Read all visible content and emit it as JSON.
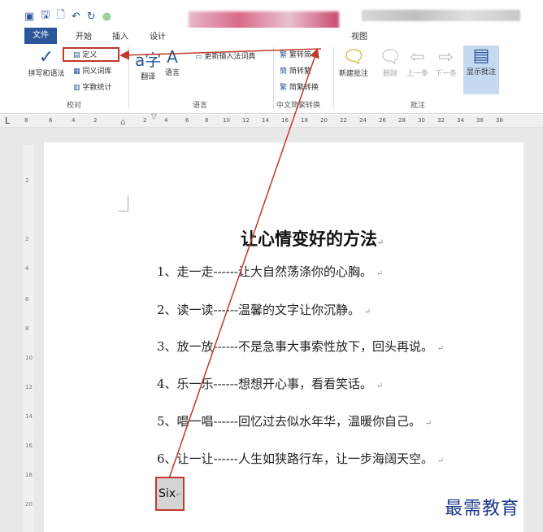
{
  "qat": {
    "icons": [
      "word-icon",
      "save-icon",
      "preview-icon",
      "undo-icon",
      "redo-icon",
      "circle-icon"
    ]
  },
  "tabs": [
    "文件",
    "开始",
    "插入",
    "设计",
    "视图"
  ],
  "ribbon": {
    "spelling": "拼写和语法",
    "define": "定义",
    "thesaurus": "同义词库",
    "wordcount": "字数统计",
    "proofing": "校对",
    "translate": "翻译",
    "language_btn": "语言",
    "language_grp": "语言",
    "ime_update": "更新输入法词典",
    "to_trad": "繁转简",
    "to_simp": "简转繁",
    "convert": "简繁转换",
    "chinese_conv": "中文简繁转换",
    "new_comment": "新建批注",
    "delete": "删除",
    "prev": "上一条",
    "next": "下一条",
    "show_comments": "显示批注",
    "comments": "批注"
  },
  "ruler": [
    "8",
    "6",
    "4",
    "2",
    "2",
    "4",
    "6",
    "8",
    "10",
    "12",
    "14",
    "16",
    "18",
    "20",
    "22",
    "24",
    "26",
    "28",
    "30",
    "32",
    "34",
    "36",
    "38"
  ],
  "vruler": [
    "2",
    "2",
    "4",
    "6",
    "8",
    "10",
    "12",
    "14",
    "16",
    "18",
    "20"
  ],
  "doc": {
    "title": "让心情变好的方法",
    "lines": [
      "1、走一走------让大自然荡涤你的心胸。",
      "2、读一读------温馨的文字让你沉静。",
      "3、放一放------不是急事大事索性放下，回头再说。",
      "4、乐一乐------想想开心事，看看笑话。",
      "5、唱一唱------回忆过去似水年华，温暖你自己。",
      "6、让一让------人生如狭路行车，让一步海阔天空。"
    ],
    "selected": "Six"
  },
  "watermark": "最需教育",
  "colors": {
    "accent": "#2b579a",
    "highlight": "#c0392b"
  }
}
